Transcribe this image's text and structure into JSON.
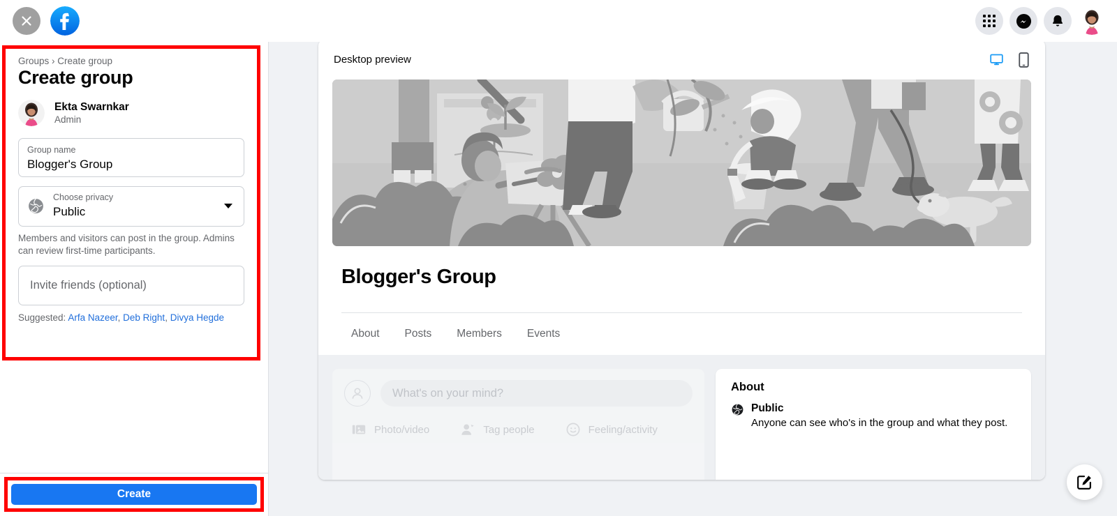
{
  "topbar": {
    "close_icon": "close-icon",
    "logo_icon": "facebook-logo-icon",
    "menu_icon": "grid-menu-icon",
    "messenger_icon": "messenger-icon",
    "notifications_icon": "bell-icon",
    "account_icon": "profile-avatar"
  },
  "left_panel": {
    "breadcrumb": "Groups › Create group",
    "title": "Create group",
    "admin": {
      "name": "Ekta Swarnkar",
      "role": "Admin"
    },
    "group_name_field": {
      "label": "Group name",
      "value": "Blogger's Group"
    },
    "privacy_field": {
      "label": "Choose privacy",
      "value": "Public",
      "icon": "globe-icon",
      "caret": "chevron-down-icon"
    },
    "privacy_helper": "Members and visitors can post in the group. Admins can review first-time participants.",
    "invite_field": {
      "placeholder": "Invite friends (optional)"
    },
    "suggested": {
      "label": "Suggested:",
      "people": [
        "Arfa Nazeer",
        "Deb Right",
        "Divya Hegde"
      ],
      "link_color": "#216fdb"
    },
    "create_button": {
      "label": "Create",
      "color": "#1877f2"
    },
    "highlight_color": "#ff0000"
  },
  "preview": {
    "header_title": "Desktop preview",
    "desktop_icon": "desktop-monitor-icon",
    "mobile_icon": "mobile-phone-icon",
    "desktop_active_color": "#1b9bf5",
    "cover_alt": "group-cover-illustration",
    "group_title": "Blogger's Group",
    "tabs": [
      {
        "label": "About"
      },
      {
        "label": "Posts"
      },
      {
        "label": "Members"
      },
      {
        "label": "Events"
      }
    ],
    "composer": {
      "placeholder": "What's on your mind?",
      "actions": [
        {
          "label": "Photo/video",
          "icon": "photo-video-icon"
        },
        {
          "label": "Tag people",
          "icon": "tag-people-icon"
        },
        {
          "label": "Feeling/activity",
          "icon": "feeling-activity-icon"
        }
      ]
    },
    "about_card": {
      "title": "About",
      "privacy": "Public",
      "privacy_icon": "globe-icon",
      "description": "Anyone can see who's in the group and what they post."
    }
  },
  "fab": {
    "icon": "compose-edit-icon"
  }
}
